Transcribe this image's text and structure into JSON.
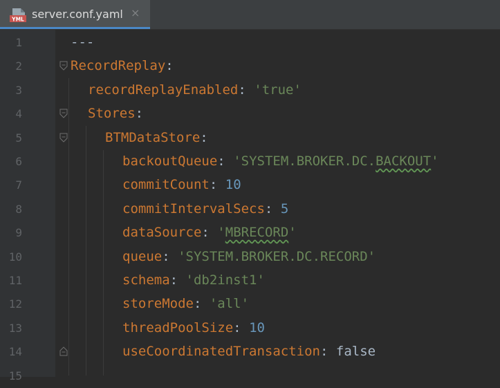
{
  "tab": {
    "icon_label": "YML",
    "title": "server.conf.yaml",
    "close_glyph": "×"
  },
  "editor": {
    "lines": [
      {
        "num": "1",
        "key": "",
        "sep": "---",
        "value": "",
        "value_pre": "",
        "value_warn": "",
        "value_post": ""
      },
      {
        "num": "2",
        "key": "RecordReplay",
        "sep": ":",
        "value": ""
      },
      {
        "num": "3",
        "key": "recordReplayEnabled",
        "sep": ":",
        "value": "'true'"
      },
      {
        "num": "4",
        "key": "Stores",
        "sep": ":",
        "value": ""
      },
      {
        "num": "5",
        "key": "BTMDataStore",
        "sep": ":",
        "value": ""
      },
      {
        "num": "6",
        "key": "backoutQueue",
        "sep": ":",
        "value_pre": "'SYSTEM.BROKER.DC.",
        "value_warn": "BACKOUT",
        "value_post": "'"
      },
      {
        "num": "7",
        "key": "commitCount",
        "sep": ":",
        "value": "10"
      },
      {
        "num": "8",
        "key": "commitIntervalSecs",
        "sep": ":",
        "value": "5"
      },
      {
        "num": "9",
        "key": "dataSource",
        "sep": ":",
        "value_pre": "'",
        "value_warn": "MBRECORD",
        "value_post": "'"
      },
      {
        "num": "10",
        "key": "queue",
        "sep": ":",
        "value": "'SYSTEM.BROKER.DC.RECORD'"
      },
      {
        "num": "11",
        "key": "schema",
        "sep": ":",
        "value": "'db2inst1'"
      },
      {
        "num": "12",
        "key": "storeMode",
        "sep": ":",
        "value": "'all'"
      },
      {
        "num": "13",
        "key": "threadPoolSize",
        "sep": ":",
        "value": "10"
      },
      {
        "num": "14",
        "key": "useCoordinatedTransaction",
        "sep": ":",
        "value": "false"
      },
      {
        "num": "15",
        "key": "",
        "sep": "",
        "value": ""
      }
    ]
  },
  "colors": {
    "keyword": "#cc7832",
    "string": "#6a8759",
    "number": "#6897bb",
    "text": "#a9b7c6",
    "line_number": "#606366",
    "tab_underline": "#4a88c7"
  }
}
